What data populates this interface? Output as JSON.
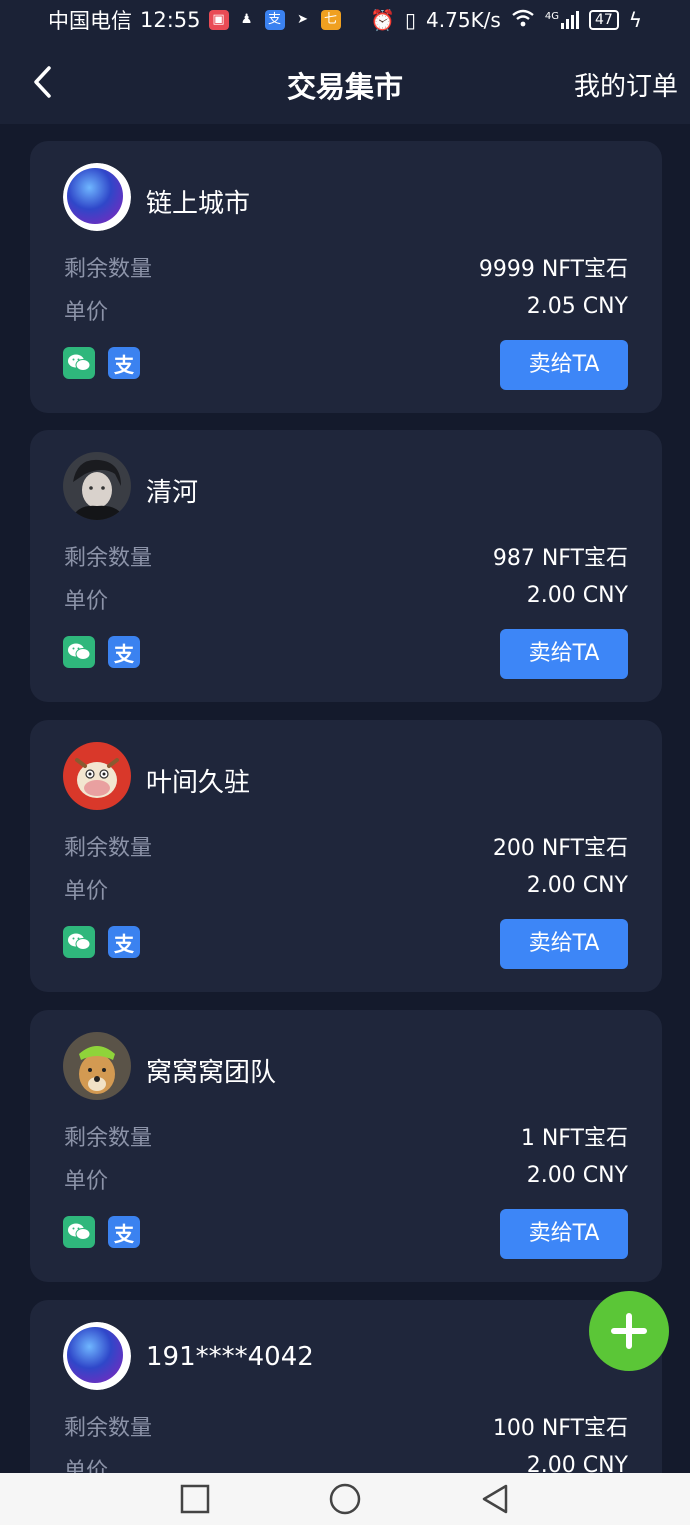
{
  "status_bar": {
    "carrier": "中国电信",
    "time": "12:55",
    "net_speed": "4.75K/s",
    "signal_label": "4G",
    "battery": "47"
  },
  "header": {
    "title": "交易集市",
    "my_orders": "我的订单"
  },
  "labels": {
    "remaining": "剩余数量",
    "unit_price": "单价",
    "sell_button": "卖给TA",
    "alipay_glyph": "支"
  },
  "listings": [
    {
      "name": "链上城市",
      "remaining": "9999 NFT宝石",
      "price": "2.05 CNY",
      "avatar": "blue-orb"
    },
    {
      "name": "清河",
      "remaining": "987 NFT宝石",
      "price": "2.00 CNY",
      "avatar": "anime-boy"
    },
    {
      "name": "叶间久驻",
      "remaining": "200 NFT宝石",
      "price": "2.00 CNY",
      "avatar": "cartoon-cow"
    },
    {
      "name": "窝窝窝团队",
      "remaining": "1 NFT宝石",
      "price": "2.00 CNY",
      "avatar": "dog-photo"
    },
    {
      "name": "191****4042",
      "remaining": "100 NFT宝石",
      "price": "2.00 CNY",
      "avatar": "blue-orb"
    }
  ],
  "colors": {
    "background": "#141a2c",
    "card": "#1f263b",
    "accent_button": "#3d86f7",
    "fab": "#5bc637",
    "label_gray": "#8c93a8"
  }
}
